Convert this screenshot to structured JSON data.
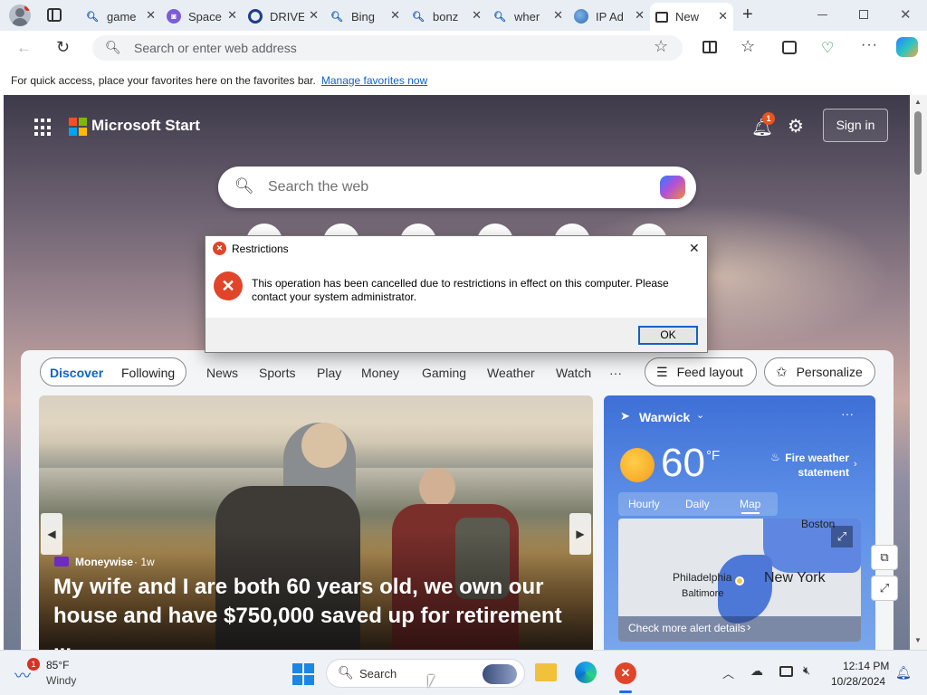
{
  "browser": {
    "tabs": [
      {
        "label": "game",
        "icon": "bing-search-icon"
      },
      {
        "label": "Space",
        "icon": "twitch-icon"
      },
      {
        "label": "DRIVE",
        "icon": "drive-circle-icon"
      },
      {
        "label": "Bing",
        "icon": "bing-search-icon"
      },
      {
        "label": "bonz",
        "icon": "bing-search-icon"
      },
      {
        "label": "wher",
        "icon": "bing-search-icon"
      },
      {
        "label": "IP Ad",
        "icon": "globe-icon"
      },
      {
        "label": "New",
        "icon": "new-tab-icon"
      }
    ],
    "address_placeholder": "Search or enter web address",
    "favorites_bar_text": "For quick access, place your favorites here on the favorites bar.",
    "favorites_bar_link": "Manage favorites now"
  },
  "start": {
    "brand": "Microsoft Start",
    "notification_count": "1",
    "sign_in_label": "Sign in",
    "search_placeholder": "Search the web"
  },
  "feed": {
    "tab_discover": "Discover",
    "tab_following": "Following",
    "nav": [
      "News",
      "Sports",
      "Play",
      "Money",
      "Gaming",
      "Weather",
      "Watch"
    ],
    "more": "···",
    "feed_layout_label": "Feed layout",
    "personalize_label": "Personalize",
    "hero": {
      "source": "Moneywise",
      "age": "· 1w",
      "headline": "My wife and I are both 60 years old, we own our house and have $750,000 saved up for retirement ..."
    },
    "weather": {
      "location": "Warwick",
      "temp": "60",
      "unit": "°F",
      "alert_line1": "Fire weather",
      "alert_line2": "statement",
      "tabs": [
        "Hourly",
        "Daily",
        "Map"
      ],
      "active_tab": "Map",
      "map_labels": {
        "boston": "Boston",
        "philadelphia": "Philadelphia",
        "baltimore": "Baltimore",
        "new_york": "New York"
      },
      "alert_details": "Check more alert details"
    }
  },
  "dialog": {
    "title": "Restrictions",
    "message": "This operation has been cancelled due to restrictions in effect on this computer. Please contact your system administrator.",
    "ok_label": "OK"
  },
  "taskbar": {
    "weather_badge": "1",
    "weather_temp": "85°F",
    "weather_desc": "Windy",
    "search_label": "Search",
    "time": "12:14 PM",
    "date": "10/28/2024"
  },
  "colors": {
    "accent": "#0f62c9",
    "error_red": "#e0452a",
    "notif_orange": "#e8541c"
  }
}
